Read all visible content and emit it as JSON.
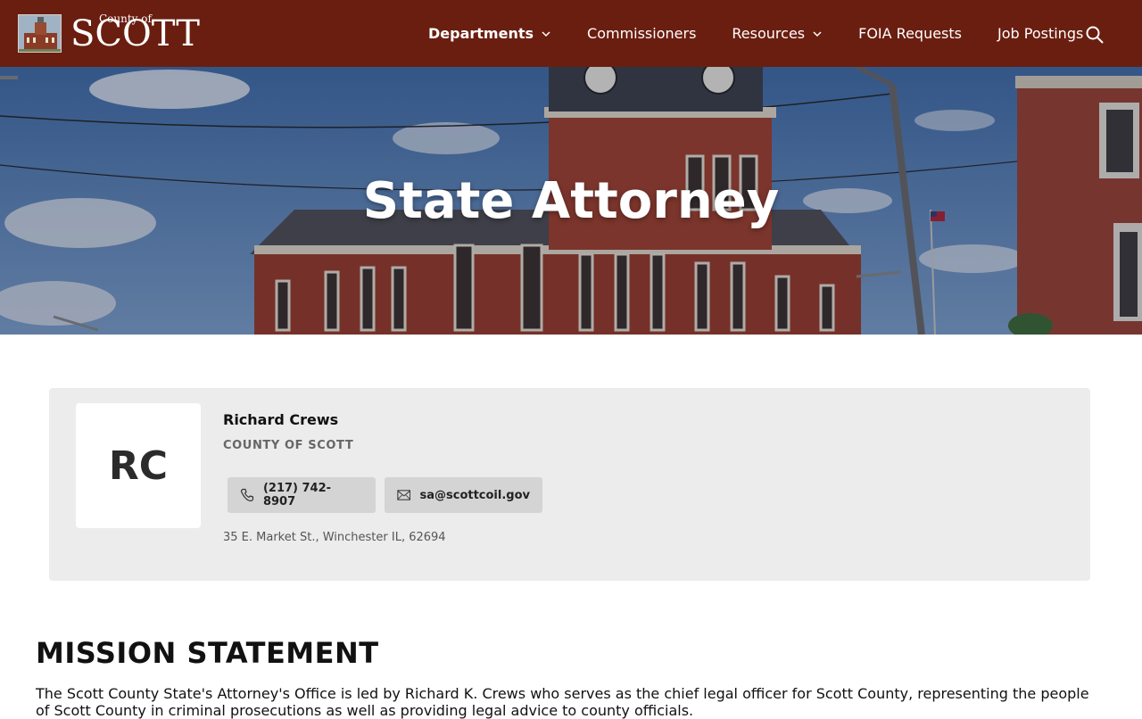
{
  "header": {
    "logo": {
      "small_text": "County of",
      "big_text": "SCOTT"
    },
    "nav": [
      {
        "label": "Departments",
        "has_dropdown": true,
        "active": true
      },
      {
        "label": "Commissioners",
        "has_dropdown": false
      },
      {
        "label": "Resources",
        "has_dropdown": true
      },
      {
        "label": "FOIA Requests",
        "has_dropdown": false
      },
      {
        "label": "Job Postings",
        "has_dropdown": false
      }
    ],
    "search_icon": "search-icon"
  },
  "hero": {
    "title": "State Attorney"
  },
  "profile": {
    "initials": "RC",
    "name": "Richard Crews",
    "organization": "COUNTY OF SCOTT",
    "phone": "(217) 742-8907",
    "email": "sa@scottcoil.gov",
    "address": "35 E. Market St., Winchester IL, 62694"
  },
  "mission": {
    "title": "MISSION STATEMENT",
    "body": "The Scott County State's Attorney's Office is led by Richard K. Crews who serves as the chief legal officer for Scott County, representing the people of Scott County in criminal prosecutions as well as providing legal advice to county officials."
  },
  "colors": {
    "header_bg": "#6a1e10",
    "card_bg": "#ececec",
    "button_bg": "#d4d4d4"
  }
}
